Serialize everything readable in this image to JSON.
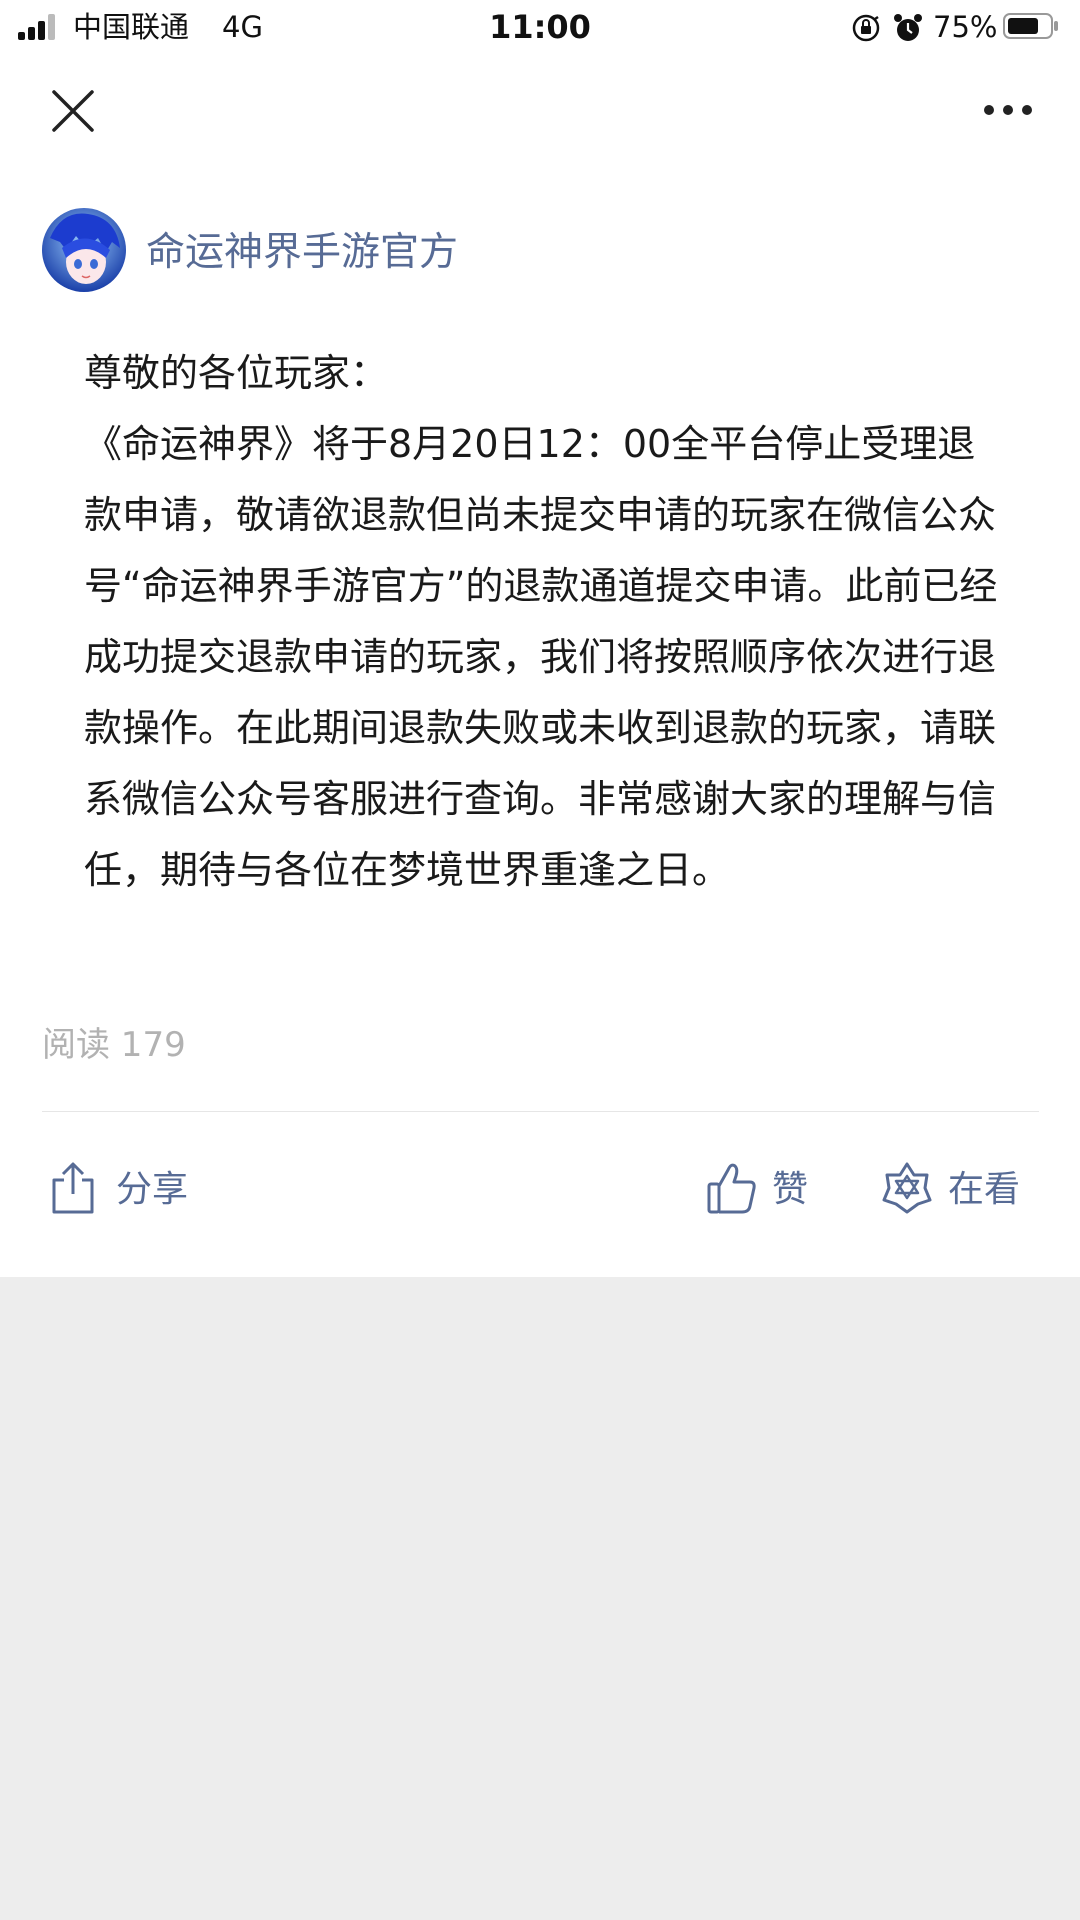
{
  "status_bar": {
    "carrier": "中国联通",
    "network": "4G",
    "time": "11:00",
    "battery_percent": "75%",
    "battery_level": 0.75,
    "signal_bars_filled": 3,
    "icons": [
      "signal-icon",
      "orientation-lock-icon",
      "alarm-icon",
      "battery-icon"
    ]
  },
  "nav": {
    "close_icon": "close-icon",
    "more_icon": "more-icon"
  },
  "account": {
    "name": "命运神界手游官方",
    "avatar_icon": "avatar"
  },
  "article": {
    "greeting": "尊敬的各位玩家：",
    "body": "《命运神界》将于8月20日12：00全平台停止受理退款申请，敬请欲退款但尚未提交申请的玩家在微信公众号“命运神界手游官方”的退款通道提交申请。此前已经成功提交退款申请的玩家，我们将按照顺序依次进行退款操作。在此期间退款失败或未收到退款的玩家，请联系微信公众号客服进行查询。非常感谢大家的理解与信任，期待与各位在梦境世界重逢之日。"
  },
  "reads": "阅读 179",
  "actions": {
    "share_label": "分享",
    "like_label": "赞",
    "wow_label": "在看"
  },
  "colors": {
    "link": "#576b95",
    "muted": "#b2b2b2",
    "background": "#ededed"
  }
}
